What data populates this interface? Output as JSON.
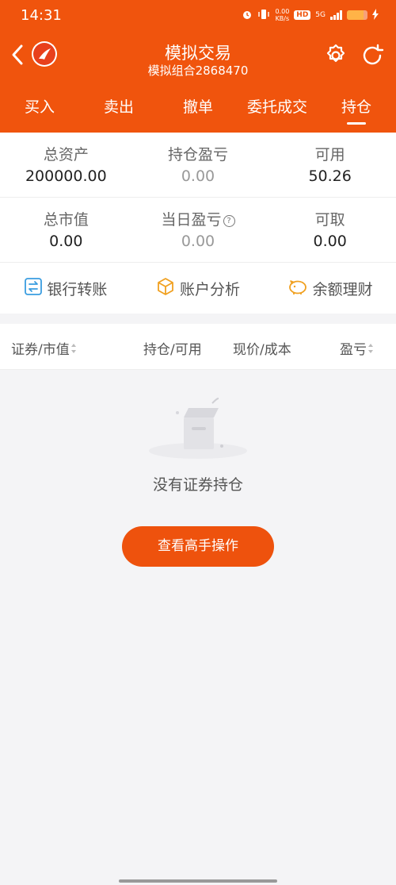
{
  "status_bar": {
    "time": "14:31",
    "net_speed_value": "0.00",
    "net_speed_unit": "KB/s",
    "hd_label": "HD",
    "network_label": "5G",
    "battery_level": 0.8
  },
  "header": {
    "title": "模拟交易",
    "subtitle": "模拟组合2868470"
  },
  "tabs": [
    {
      "label": "买入",
      "active": false
    },
    {
      "label": "卖出",
      "active": false
    },
    {
      "label": "撤单",
      "active": false
    },
    {
      "label": "委托成交",
      "active": false
    },
    {
      "label": "持仓",
      "active": true
    }
  ],
  "summary": {
    "total_assets": {
      "label": "总资产",
      "value": "200000.00"
    },
    "position_pl": {
      "label": "持仓盈亏",
      "value": "0.00"
    },
    "available": {
      "label": "可用",
      "value": "50.26"
    },
    "market_value": {
      "label": "总市值",
      "value": "0.00"
    },
    "daily_pl": {
      "label": "当日盈亏",
      "value": "0.00"
    },
    "withdrawable": {
      "label": "可取",
      "value": "0.00"
    }
  },
  "actions": [
    {
      "label": "银行转账",
      "icon": "bank-transfer-icon"
    },
    {
      "label": "账户分析",
      "icon": "box-analysis-icon"
    },
    {
      "label": "余额理财",
      "icon": "piggy-bank-icon"
    }
  ],
  "table": {
    "columns": [
      "证券/市值",
      "持仓/可用",
      "现价/成本",
      "盈亏"
    ]
  },
  "empty_state": {
    "message": "没有证券持仓",
    "button_label": "查看高手操作"
  },
  "colors": {
    "brand": "#f0540d",
    "button": "#ee520d",
    "background": "#f4f4f6"
  }
}
